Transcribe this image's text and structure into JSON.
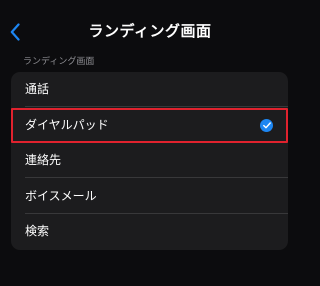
{
  "nav": {
    "title": "ランディング画面",
    "back_icon": "chevron-left-icon"
  },
  "section": {
    "header": "ランディング画面"
  },
  "options": [
    {
      "label": "通話",
      "selected": false
    },
    {
      "label": "ダイヤルパッド",
      "selected": true
    },
    {
      "label": "連絡先",
      "selected": false
    },
    {
      "label": "ボイスメール",
      "selected": false
    },
    {
      "label": "検索",
      "selected": false
    }
  ],
  "colors": {
    "accent": "#1d86f2",
    "highlight_outline": "#e0222e",
    "background": "#0c0c0e",
    "list_background": "#1c1c1e"
  },
  "icons": {
    "selected_indicator": "checkmark-circle-icon"
  }
}
